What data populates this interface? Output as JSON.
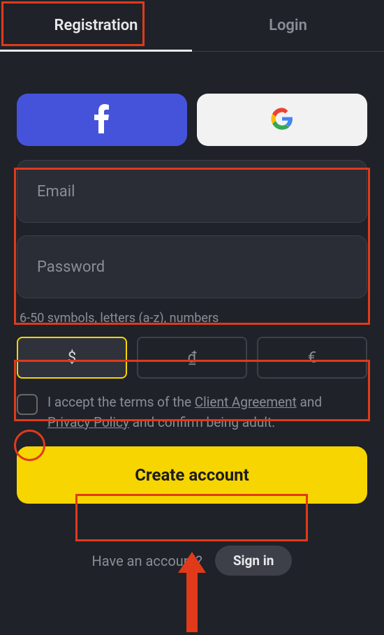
{
  "tabs": {
    "registration": "Registration",
    "login": "Login"
  },
  "form": {
    "email_placeholder": "Email",
    "password_placeholder": "Password",
    "password_hint": "6-50 symbols, letters (a-z), numbers"
  },
  "currencies": {
    "usd": "$",
    "vnd": "₫",
    "eur": "€"
  },
  "terms": {
    "prefix": "I accept the terms of the ",
    "client_agreement": "Client Agreement",
    "and": " and ",
    "privacy_policy": "Privacy Policy",
    "suffix": " and confirm being adult."
  },
  "buttons": {
    "create_account": "Create account",
    "sign_in": "Sign in"
  },
  "have_account": "Have an account?"
}
